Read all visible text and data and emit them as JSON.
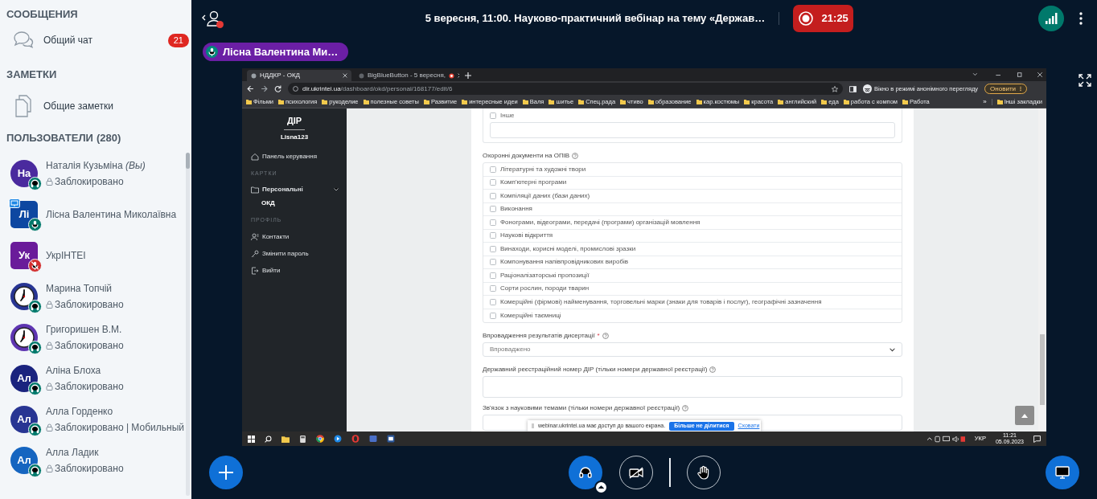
{
  "sidebar": {
    "messages": {
      "title": "СООБЩЕНИЯ",
      "items": [
        {
          "label": "Общий чат",
          "badge": "21"
        }
      ]
    },
    "notes": {
      "title": "ЗАМЕТКИ",
      "items": [
        {
          "label": "Общие заметки"
        }
      ]
    },
    "users": {
      "title": "ПОЛЬЗОВАТЕЛИ",
      "count": "(280)",
      "items": [
        {
          "kind": "initials",
          "initials": "На",
          "name": "Наталія Кузьміна *(Вы)*",
          "status": "Заблокировано",
          "color": "#4a2a9e",
          "moderator": false,
          "presenter": false,
          "audio": {
            "kind": "listen"
          }
        },
        {
          "kind": "initials",
          "initials": "Лі",
          "name": "Лісна Валентина Миколаївна",
          "color": "#0d47a1",
          "moderator": true,
          "presenter": true,
          "audio": {
            "kind": "mic"
          }
        },
        {
          "kind": "initials",
          "initials": "Ук",
          "name": "УкрІНТЕІ",
          "color": "#6a1b9a",
          "moderator": true,
          "presenter": false,
          "audio": {
            "kind": "muted"
          }
        },
        {
          "kind": "clock",
          "name": "Марина Топчій",
          "status": "Заблокировано",
          "color": "#283593",
          "moderator": false,
          "presenter": false,
          "audio": {
            "kind": "listen"
          }
        },
        {
          "kind": "clock",
          "name": "Григоришен В.М.",
          "status": "Заблокировано",
          "color": "#5e35b1",
          "moderator": false,
          "presenter": false,
          "audio": {
            "kind": "listen"
          }
        },
        {
          "kind": "initials",
          "initials": "Ал",
          "name": "Аліна Блоха",
          "status": "Заблокировано",
          "color": "#1a237e",
          "moderator": false,
          "presenter": false,
          "audio": {
            "kind": "listen"
          }
        },
        {
          "kind": "initials",
          "initials": "Ал",
          "name": "Алла Горденко",
          "status": "Заблокировано | Мобильный",
          "color": "#283593",
          "moderator": false,
          "presenter": false,
          "audio": {
            "kind": "listen"
          }
        },
        {
          "kind": "initials",
          "initials": "Ал",
          "name": "Алла Ладик",
          "status": "Заблокировано",
          "color": "#1565c0",
          "moderator": false,
          "presenter": false,
          "audio": {
            "kind": "listen"
          }
        }
      ]
    }
  },
  "topbar": {
    "notification": true,
    "title": "5 вересня, 11:00. Науково-практичний вебінар на тему «Держав…",
    "recording": {
      "on": true,
      "time": "21:25"
    },
    "presenter": "Лісна Валентина Ми…"
  },
  "share": {
    "browser": {
      "tabs": [
        {
          "label": "НДДКР - ОКД",
          "selected": true,
          "recording": false
        },
        {
          "label": "BigBlueButton - 5 вересня, ",
          "selected": false,
          "recording": true
        }
      ],
      "url_host": "dir.ukrintei.ua",
      "url_path": "/dashboard/okd/personal/168177/edit/6",
      "incognito": "Вікно в режимі анонімного перегляду",
      "update": "Оновити",
      "bookmarks": [
        "Фільми",
        "психология",
        "рукоделие",
        "полезные советы",
        "Развитие",
        "интересные идеи",
        "Валя",
        "шитье",
        "Спец.рада",
        "чтиво",
        "образование",
        "кар.костюмы",
        "красота",
        "английский",
        "еда",
        "работа с компом",
        "Работа"
      ],
      "more": "»",
      "other_bookmarks": "Інші закладки"
    },
    "page": {
      "brand": "ДІР",
      "user": "Lisna123",
      "nav": [
        {
          "kind": "home",
          "label": "Панель керування"
        },
        {
          "kind": "section",
          "label": "КАРТКИ"
        },
        {
          "kind": "folder",
          "label": "Персональні",
          "expanded": true
        },
        {
          "kind": "sub",
          "label": "ОКД"
        },
        {
          "kind": "section",
          "label": "ПРОФІЛЬ"
        },
        {
          "kind": "contacts",
          "label": "Контакти"
        },
        {
          "kind": "key",
          "label": "Змінити пароль"
        },
        {
          "kind": "logout",
          "label": "Вийти"
        }
      ],
      "other": {
        "label": "Інше",
        "checked": false
      },
      "fields": [
        {
          "kind": "checklist",
          "label": "Охоронні документи на ОПІВ",
          "options": [
            {
              "label": "Літературні та художні твори",
              "checked": false
            },
            {
              "label": "Комп'ютерні програми",
              "checked": false
            },
            {
              "label": "Компіляції даних (бази даних)",
              "checked": false
            },
            {
              "label": "Виконання",
              "checked": false
            },
            {
              "label": "Фонограми, відеограми, передачі (програми) організацій мовлення",
              "checked": false
            },
            {
              "label": "Наукові відкриття",
              "checked": false
            },
            {
              "label": "Винаходи, корисні моделі, промислові зразки",
              "checked": false
            },
            {
              "label": "Компонування напівпровідникових виробів",
              "checked": false
            },
            {
              "label": "Раціоналізаторські пропозиції",
              "checked": false
            },
            {
              "label": "Сорти рослин, породи тварин",
              "checked": false
            },
            {
              "label": "Комерційні (фірмові) найменування, торговельні марки (знаки для товарів і послуг), географічні зазначення",
              "checked": false
            },
            {
              "label": "Комерційні таємниці",
              "checked": false
            }
          ]
        },
        {
          "kind": "select",
          "label": "Впровадження результатів дисертації",
          "required_mark": "*",
          "value": "Впроваджено"
        },
        {
          "kind": "textarea",
          "label": "Державний реєстраційний номер ДІР (тільки номери державної реєстрації)"
        },
        {
          "kind": "input",
          "label": "Зв'язок з науковими темами (тільки номери державної реєстрації)"
        }
      ],
      "notice": {
        "text": "webinar.ukrintei.ua має доступ до вашого екрана.",
        "button": "Більше не ділитися",
        "link": "Сховати"
      }
    },
    "taskbar": {
      "language": "УКР",
      "time": "11:21",
      "date": "05.09.2023"
    }
  },
  "bottom_bar": {
    "controls": [
      {
        "kind": "audio",
        "on": true
      },
      {
        "kind": "camera",
        "on": false
      },
      {
        "kind": "hand",
        "on": false
      }
    ],
    "screen_share": {
      "on": true
    }
  }
}
